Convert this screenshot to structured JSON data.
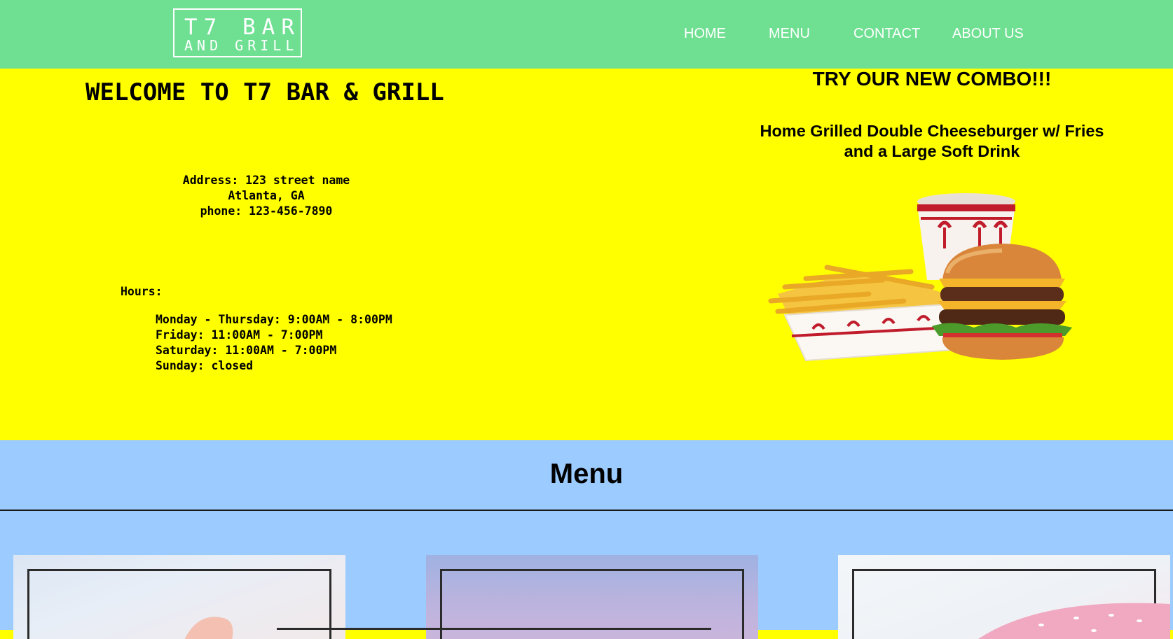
{
  "header": {
    "logo_line1": "T7 BAR",
    "logo_line2": "AND GRILL",
    "nav": [
      "HOME",
      "MENU",
      "CONTACT",
      "ABOUT US"
    ]
  },
  "welcome": {
    "title": "WELCOME TO T7 BAR & GRILL",
    "address_line1": "Address: 123 street name",
    "address_line2": "Atlanta, GA",
    "phone": "phone: 123-456-7890",
    "hours_label": "Hours:",
    "hours": [
      "Monday - Thursday: 9:00AM - 8:00PM",
      "Friday: 11:00AM - 7:00PM",
      "Saturday: 11:00AM - 7:00PM",
      "Sunday: closed"
    ]
  },
  "promo": {
    "title": "TRY OUR NEW COMBO!!!",
    "description": "Home Grilled Double Cheeseburger w/ Fries and a Large Soft Drink",
    "image_icon": "burger-combo-illustration"
  },
  "menu": {
    "title": "Menu"
  },
  "colors": {
    "header_bg": "#6fdf92",
    "hero_bg": "#ffff00",
    "menu_bg": "#9bcbff",
    "text": "#000000",
    "nav_text": "#ffffff"
  }
}
